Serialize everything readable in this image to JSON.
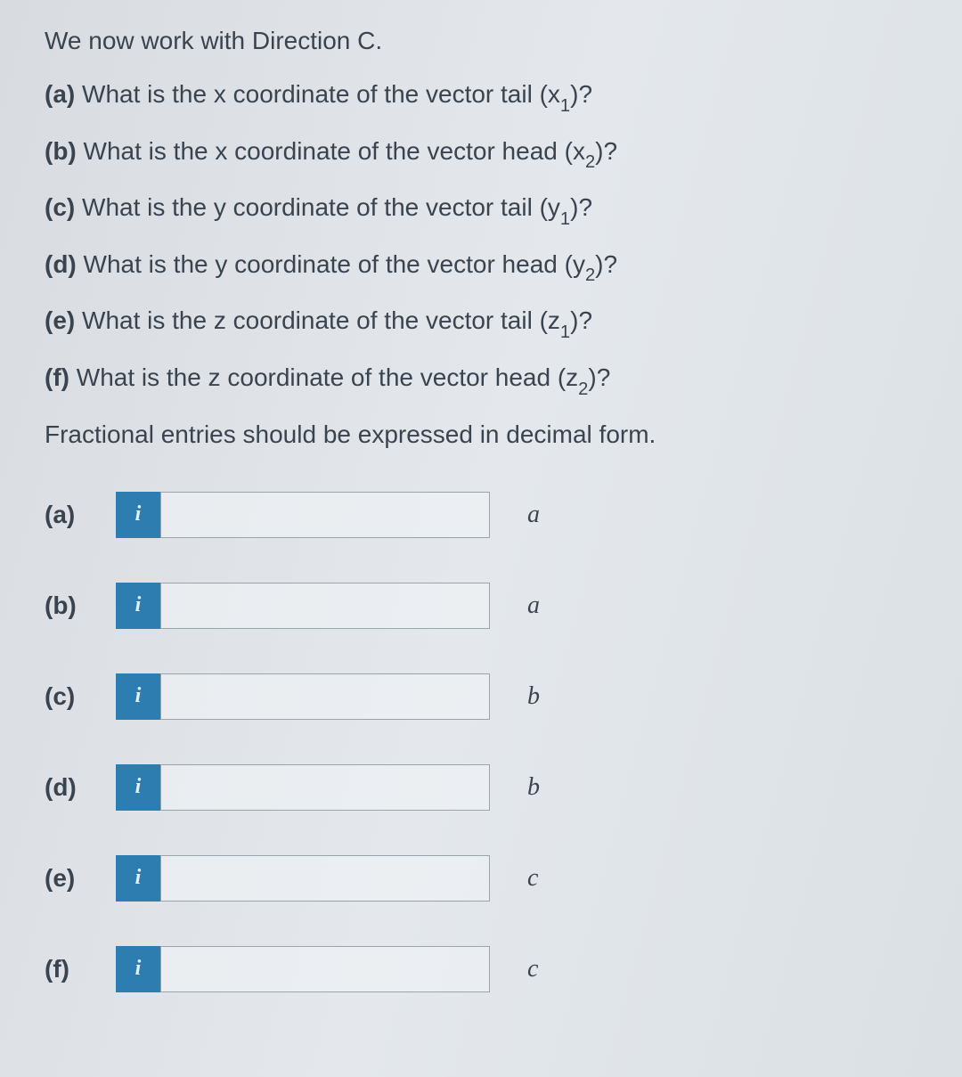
{
  "intro": "We now work with Direction C.",
  "questions": {
    "a": {
      "label": "(a)",
      "text_before": " What is the x coordinate of the vector tail (x",
      "sub": "1",
      "text_after": ")?"
    },
    "b": {
      "label": "(b)",
      "text_before": " What is the x coordinate of the vector head (x",
      "sub": "2",
      "text_after": ")?"
    },
    "c": {
      "label": "(c)",
      "text_before": " What is the y coordinate of the vector tail (y",
      "sub": "1",
      "text_after": ")?"
    },
    "d": {
      "label": "(d)",
      "text_before": " What is the y coordinate of the vector head (y",
      "sub": "2",
      "text_after": ")?"
    },
    "e": {
      "label": "(e)",
      "text_before": " What is the z coordinate of the vector tail (z",
      "sub": "1",
      "text_after": ")?"
    },
    "f": {
      "label": "(f)",
      "text_before": " What is the z coordinate of the vector head (z",
      "sub": "2",
      "text_after": ")?"
    }
  },
  "note": "Fractional entries should be expressed in decimal form.",
  "answers": {
    "a": {
      "label": "(a)",
      "unit": "a",
      "value": ""
    },
    "b": {
      "label": "(b)",
      "unit": "a",
      "value": ""
    },
    "c": {
      "label": "(c)",
      "unit": "b",
      "value": ""
    },
    "d": {
      "label": "(d)",
      "unit": "b",
      "value": ""
    },
    "e": {
      "label": "(e)",
      "unit": "c",
      "value": ""
    },
    "f": {
      "label": "(f)",
      "unit": "c",
      "value": ""
    }
  },
  "info_icon": "i"
}
